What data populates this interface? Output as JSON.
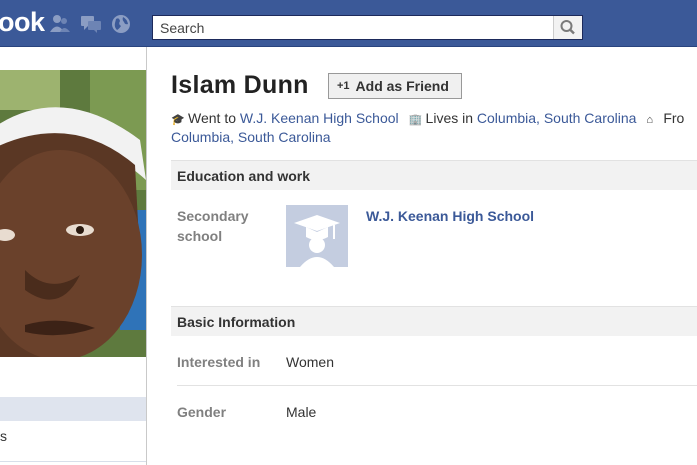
{
  "header": {
    "logo_text": "ook",
    "search_placeholder": "Search",
    "brand_color": "#3b5998",
    "icons": [
      "friend-requests-icon",
      "messages-icon",
      "notifications-globe-icon",
      "search-icon"
    ]
  },
  "profile": {
    "name": "Islam Dunn",
    "add_friend_label": "Add as Friend",
    "add_friend_icon": "+1",
    "intro": {
      "went_to_prefix": "Went to",
      "school": "W.J. Keenan High School",
      "lives_in_prefix": "Lives in",
      "lives_in": "Columbia, South Carolina",
      "from_prefix": "Fro",
      "from_wrapped": "Columbia, South Carolina"
    }
  },
  "education": {
    "section_title": "Education and work",
    "label": "Secondary school",
    "school_name": "W.J. Keenan High School"
  },
  "basic_info": {
    "section_title": "Basic Information",
    "rows": [
      {
        "label": "Interested in",
        "value": "Women"
      },
      {
        "label": "Gender",
        "value": "Male"
      }
    ]
  },
  "left_nav": {
    "partial_item": "s"
  }
}
